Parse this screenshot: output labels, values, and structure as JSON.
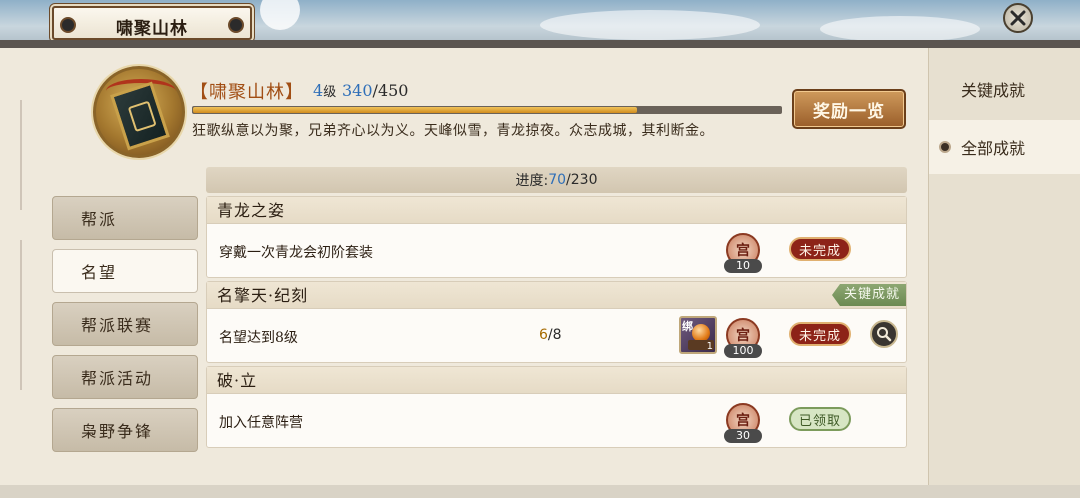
{
  "window": {
    "title": "啸聚山林"
  },
  "header": {
    "title": "【啸聚山林】",
    "level": "4",
    "level_unit": "级",
    "exp_current": "340",
    "exp_total": "/450",
    "exp_fraction": 0.755,
    "description": "狂歌纵意以为聚，兄弟齐心以为义。天峰似雪，青龙掠夜。众志成城，其利断金。",
    "reward_button": "奖励一览"
  },
  "left_nav": [
    {
      "label": "帮派",
      "active": false
    },
    {
      "label": "名望",
      "active": true
    },
    {
      "label": "帮派联赛",
      "active": false
    },
    {
      "label": "帮派活动",
      "active": false
    },
    {
      "label": "枭野争锋",
      "active": false
    }
  ],
  "right_tabs": [
    {
      "label": "关键成就",
      "active": false
    },
    {
      "label": "全部成就",
      "active": true
    }
  ],
  "progress": {
    "label": "进度:",
    "current": "70",
    "total": "/230"
  },
  "achievements": [
    {
      "title": "青龙之姿",
      "desc": "穿戴一次青龙会初阶套装",
      "progress_current": "",
      "progress_total": "",
      "key_tag": "",
      "has_item": false,
      "reward_icon": "宫",
      "reward_amount": "10",
      "status": "未完成",
      "status_type": "undone",
      "has_search": false
    },
    {
      "title": "名擎天·纪刻",
      "desc": "名望达到8级",
      "progress_current": "6",
      "progress_total": "/8",
      "key_tag": "关键成就",
      "has_item": true,
      "item_bind": "绑",
      "item_qty": "1",
      "reward_icon": "宫",
      "reward_amount": "100",
      "status": "未完成",
      "status_type": "undone",
      "has_search": true
    },
    {
      "title": "破·立",
      "desc": "加入任意阵营",
      "progress_current": "",
      "progress_total": "",
      "key_tag": "",
      "has_item": false,
      "reward_icon": "宫",
      "reward_amount": "30",
      "status": "已领取",
      "status_type": "claimed",
      "has_search": false
    }
  ],
  "icons": {
    "close": "close-icon",
    "search": "magnifier-icon",
    "emblem": "guild-emblem",
    "right_tab_marker": "bullet-icon"
  }
}
